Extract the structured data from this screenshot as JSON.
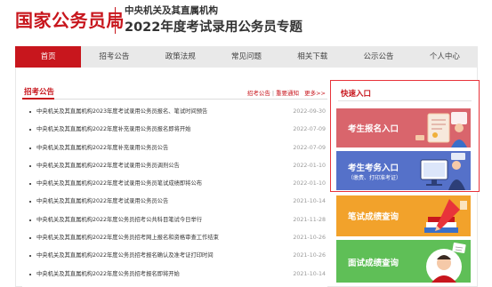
{
  "header": {
    "site_title": "国家公务员局",
    "org_name": "中央机关及其直属机构",
    "topic_title": "2022年度考试录用公务员专题"
  },
  "nav": {
    "items": [
      {
        "label": "首页",
        "active": true
      },
      {
        "label": "招考公告",
        "active": false
      },
      {
        "label": "政策法规",
        "active": false
      },
      {
        "label": "常见问题",
        "active": false
      },
      {
        "label": "相关下载",
        "active": false
      },
      {
        "label": "公示公告",
        "active": false
      },
      {
        "label": "个人中心",
        "active": false
      }
    ]
  },
  "notices": {
    "title": "招考公告",
    "link_announce": "招考公告",
    "link_important": "重要通知",
    "more": "更多>>",
    "items": [
      {
        "title": "中央机关及其直属机构2023年度考试录用公务员报名、笔试时间预告",
        "date": "2022-09-30"
      },
      {
        "title": "中央机关及其直属机构2022年度补充录用公务员报名即将开始",
        "date": "2022-07-09"
      },
      {
        "title": "中央机关及其直属机构2022年度补充录用公务员公告",
        "date": "2022-07-09"
      },
      {
        "title": "中央机关及其直属机构2022年度考试录用公务员调剂公告",
        "date": "2022-01-10"
      },
      {
        "title": "中央机关及其直属机构2022年度考试录用公务员笔试成绩即将公布",
        "date": "2022-01-10"
      },
      {
        "title": "中央机关及其直属机构2022年度考试录用公务员公告",
        "date": "2021-10-14"
      },
      {
        "title": "中央机关及其直属机构2022年度公务员招考公共科目笔试今日举行",
        "date": "2021-11-28"
      },
      {
        "title": "中央机关及其直属机构2022年度公务员招考网上报名和资格审查工作结束",
        "date": "2021-10-26"
      },
      {
        "title": "中央机关及其直属机构2022年度公务员招考报名确认及准考证打印时间",
        "date": "2021-10-26"
      },
      {
        "title": "中央机关及其直属机构2022年度公务员招考报名即将开始",
        "date": "2021-10-14"
      }
    ]
  },
  "quick_entry": {
    "title": "快速入口",
    "entries": [
      {
        "label": "考生报名入口",
        "sub": "",
        "color": "#d9656c"
      },
      {
        "label": "考生考务入口",
        "sub": "（缴费、打印准考证）",
        "color": "#5571c9"
      },
      {
        "label": "笔试成绩查询",
        "sub": "",
        "color": "#f2a22b"
      },
      {
        "label": "面试成绩查询",
        "sub": "",
        "color": "#5fbf57"
      }
    ]
  }
}
